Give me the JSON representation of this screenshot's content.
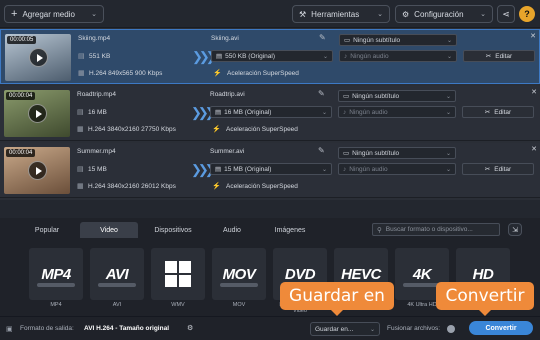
{
  "toolbar": {
    "add_media": "Agregar medio",
    "tools": "Herramientas",
    "settings": "Configuración",
    "help": "?"
  },
  "files": [
    {
      "timecode": "00:00:05",
      "source_name": "Skiing.mp4",
      "source_size": "551 KB",
      "source_info": "H.264 849x565 900 Kbps",
      "output_name": "Skiing.avi",
      "output_size": "550 KB (Original)",
      "acceleration": "Aceleración SuperSpeed",
      "subtitle": "Ningún subtítulo",
      "audio": "Ningún audio",
      "edit": "Editar",
      "selected": true,
      "thumb_colors": [
        "#b8c6d3",
        "#4d5d6e"
      ]
    },
    {
      "timecode": "00:00:04",
      "source_name": "Roadtrip.mp4",
      "source_size": "16 MB",
      "source_info": "H.264 3840x2160 27750 Kbps",
      "output_name": "Roadtrip.avi",
      "output_size": "16 MB (Original)",
      "acceleration": "Aceleración SuperSpeed",
      "subtitle": "Ningún subtítulo",
      "audio": "Ningún audio",
      "edit": "Editar",
      "selected": false,
      "thumb_colors": [
        "#8a9a6c",
        "#3f4a2e"
      ]
    },
    {
      "timecode": "00:00:04",
      "source_name": "Summer.mp4",
      "source_size": "15 MB",
      "source_info": "H.264 3840x2160 26012 Kbps",
      "output_name": "Summer.avi",
      "output_size": "15 MB (Original)",
      "acceleration": "Aceleración SuperSpeed",
      "subtitle": "Ningún subtítulo",
      "audio": "Ningún audio",
      "edit": "Editar",
      "selected": false,
      "thumb_colors": [
        "#c9a98a",
        "#6b4f3a"
      ]
    }
  ],
  "tabs": [
    "Popular",
    "Video",
    "Dispositivos",
    "Audio",
    "Imágenes"
  ],
  "active_tab": "Video",
  "search_placeholder": "Buscar formato o dispositivo...",
  "formats": [
    {
      "big": "MP4",
      "label": "MP4"
    },
    {
      "big": "AVI",
      "label": "AVI"
    },
    {
      "big": "WMV",
      "label": "WMV"
    },
    {
      "big": "MOV",
      "label": "MOV"
    },
    {
      "big": "DVD",
      "label": "DVD-Compatible Video"
    },
    {
      "big": "HEVC",
      "label": "HEVC"
    },
    {
      "big": "4K",
      "label": "4K Ultra HD"
    },
    {
      "big": "HD",
      "label": "HD"
    }
  ],
  "bottom": {
    "output_format_label": "Formato de salida:",
    "output_format_value": "AVI H.264 - Tamaño original",
    "save_to": "Guardar en...",
    "merge_files": "Fusionar archivos:",
    "convert": "Convertir"
  },
  "callouts": {
    "save_to": "Guardar en",
    "convert": "Convertir"
  },
  "colors": {
    "accent": "#3a86d8",
    "callout": "#ef8a3a",
    "help": "#e8a52b"
  }
}
